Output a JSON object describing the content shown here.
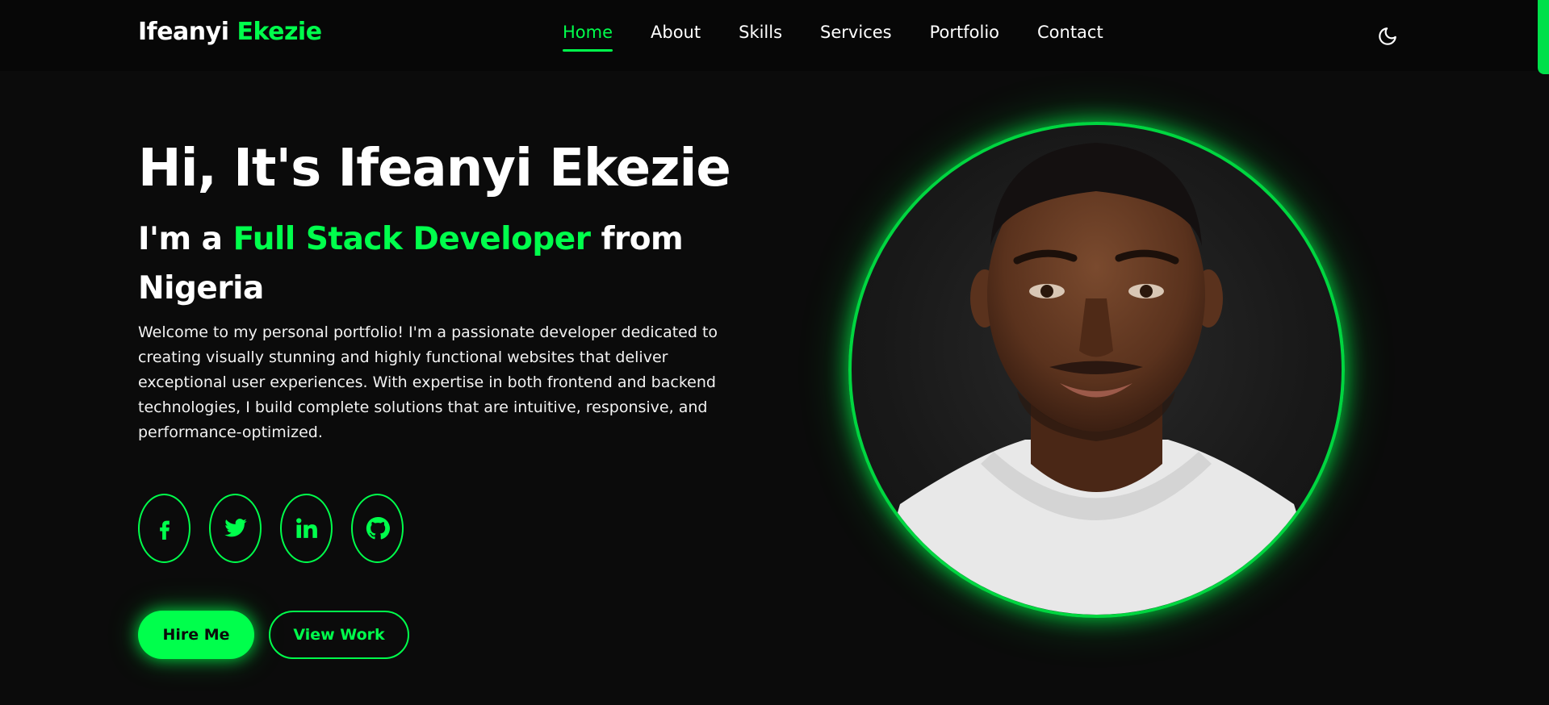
{
  "header": {
    "logo_first": "Ifeanyi",
    "logo_last": "Ekezie",
    "nav": [
      {
        "label": "Home",
        "active": true
      },
      {
        "label": "About",
        "active": false
      },
      {
        "label": "Skills",
        "active": false
      },
      {
        "label": "Services",
        "active": false
      },
      {
        "label": "Portfolio",
        "active": false
      },
      {
        "label": "Contact",
        "active": false
      }
    ],
    "theme_icon": "moon-icon"
  },
  "hero": {
    "title": "Hi, It's Ifeanyi Ekezie",
    "subtitle_prefix": "I'm a",
    "role": "Full Stack Developer",
    "subtitle_suffix": "from Nigeria",
    "description": "Welcome to my personal portfolio! I'm a passionate developer dedicated to creating visually stunning and highly functional websites that deliver exceptional user experiences. With expertise in both frontend and backend technologies, I build complete solutions that are intuitive, responsive, and performance-optimized.",
    "socials": [
      {
        "icon": "facebook-icon"
      },
      {
        "icon": "twitter-icon"
      },
      {
        "icon": "linkedin-icon"
      },
      {
        "icon": "github-icon"
      }
    ],
    "primary_button": "Hire Me",
    "secondary_button": "View Work",
    "portrait_icon": "profile-photo"
  },
  "colors": {
    "accent": "#00ff4c",
    "background": "#0b0b0b",
    "text": "#ffffff"
  }
}
